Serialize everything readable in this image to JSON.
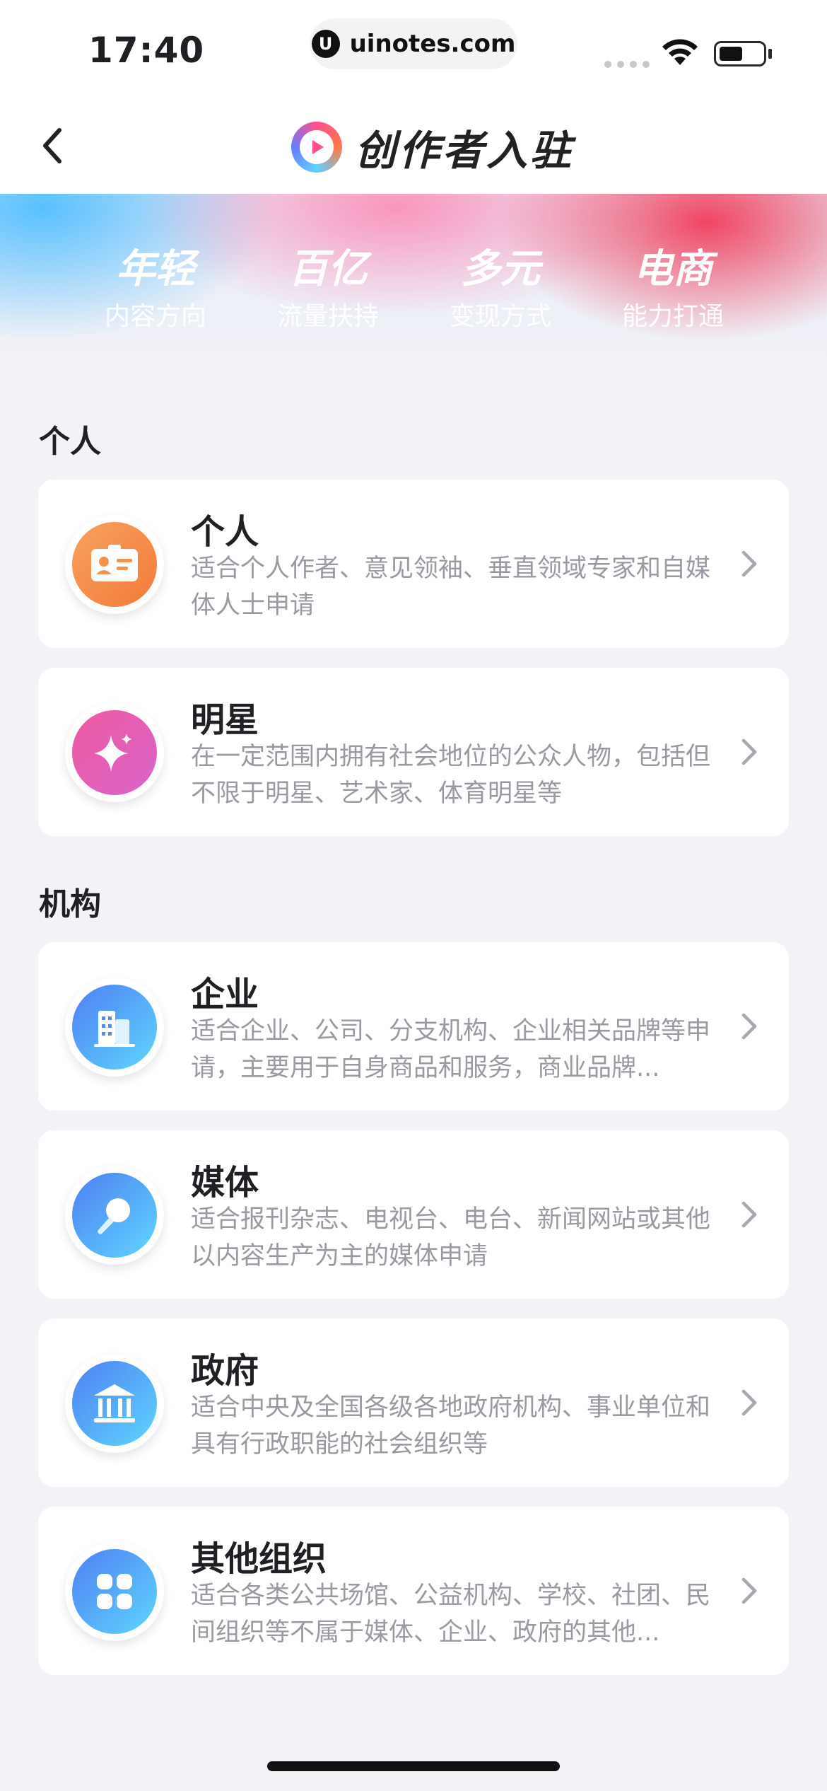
{
  "status_bar": {
    "time": "17:40",
    "url": "uinotes.com",
    "url_logo": "U",
    "icons": [
      "signal-icon",
      "wifi-icon",
      "battery-icon"
    ]
  },
  "nav": {
    "back_icon": "chevron-left-icon",
    "brand_icon": "play-logo-icon",
    "title": "创作者入驻"
  },
  "banner": {
    "features": [
      {
        "big": "年轻",
        "small": "内容方向"
      },
      {
        "big": "百亿",
        "small": "流量扶持"
      },
      {
        "big": "多元",
        "small": "变现方式"
      },
      {
        "big": "电商",
        "small": "能力打通"
      }
    ]
  },
  "sections": {
    "personal": {
      "title": "个人",
      "cards": [
        {
          "title": "个人",
          "desc": "适合个人作者、意见领袖、垂直领域专家和自媒体人士申请",
          "icon": "id-card-icon",
          "color": "#f4934f"
        },
        {
          "title": "明星",
          "desc": "在一定范围内拥有社会地位的公众人物，包括但不限于明星、艺术家、体育明星等",
          "icon": "sparkle-icon",
          "color": "#ea5aa9"
        }
      ]
    },
    "org": {
      "title": "机构",
      "cards": [
        {
          "title": "企业",
          "desc": "适合企业、公司、分支机构、企业相关品牌等申请，主要用于自身商品和服务，商业品牌...",
          "icon": "building-icon",
          "color": "#4f8af5"
        },
        {
          "title": "媒体",
          "desc": "适合报刊杂志、电视台、电台、新闻网站或其他以内容生产为主的媒体申请",
          "icon": "microphone-icon",
          "color": "#4f8af5"
        },
        {
          "title": "政府",
          "desc": "适合中央及全国各级各地政府机构、事业单位和具有行政职能的社会组织等",
          "icon": "government-icon",
          "color": "#4f8af5"
        },
        {
          "title": "其他组织",
          "desc": "适合各类公共场馆、公益机构、学校、社团、民间组织等不属于媒体、企业、政府的其他...",
          "icon": "grid-icon",
          "color": "#4f8af5"
        }
      ]
    }
  }
}
